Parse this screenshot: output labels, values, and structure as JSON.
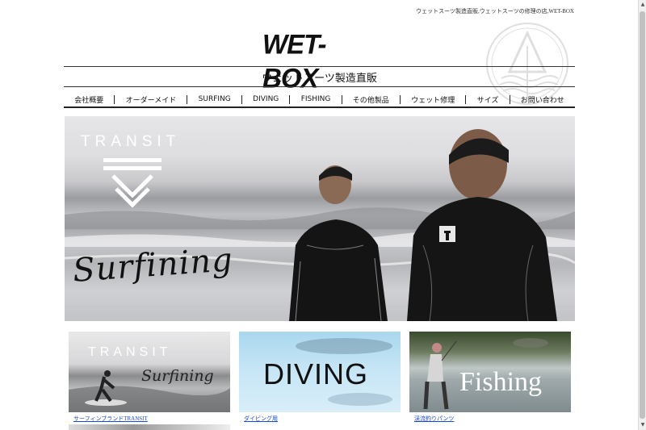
{
  "header": {
    "tagline": "ウェットスーツ製造直販,ウェットスーツの修理の店,WET-BOX",
    "logo": "WET-BOX",
    "subtitle": "ウェットスーツ製造直販"
  },
  "nav": {
    "items": [
      {
        "label": "会社概要"
      },
      {
        "label": "オーダーメイド"
      },
      {
        "label": "SURFING"
      },
      {
        "label": "DIVING"
      },
      {
        "label": "FISHING"
      },
      {
        "label": "その他製品"
      },
      {
        "label": "ウェット修理"
      },
      {
        "label": "サイズ"
      },
      {
        "label": "お問い合わせ"
      }
    ]
  },
  "hero": {
    "brand": "TRANSIT",
    "script": "Surfining"
  },
  "tiles": [
    {
      "brand": "TRANSIT",
      "script": "Surfining",
      "caption": "サーフィンブランドTRANSIT"
    },
    {
      "text": "DIVING",
      "caption": "ダイビング用"
    },
    {
      "text": "Fishing",
      "caption": "渓流釣りパンツ"
    }
  ]
}
